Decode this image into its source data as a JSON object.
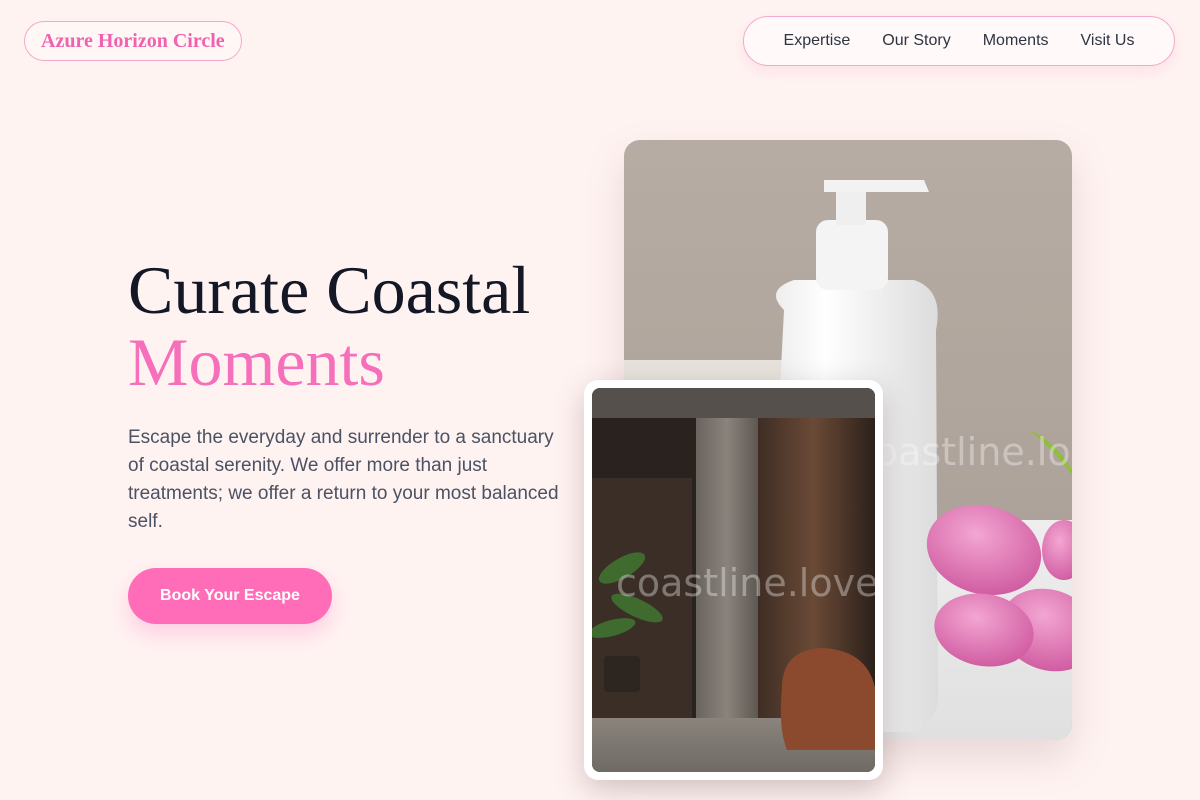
{
  "brand": {
    "name": "Azure Horizon Circle"
  },
  "nav": {
    "items": [
      {
        "label": "Expertise"
      },
      {
        "label": "Our Story"
      },
      {
        "label": "Moments"
      },
      {
        "label": "Visit Us"
      }
    ]
  },
  "hero": {
    "title_line1": "Curate Coastal",
    "title_line2": "Moments",
    "description": "Escape the everyday and surrender to a sanctuary of coastal serenity. We offer more than just treatments; we offer a return to your most balanced self.",
    "cta_label": "Book Your Escape"
  },
  "images": {
    "main_watermark": "coastline.love",
    "inset_watermark": "coastline.love"
  },
  "colors": {
    "background": "#fff3f2",
    "accent": "#f56fba",
    "cta": "#ff6db8",
    "text_dark": "#141826",
    "text_body": "#4b5263"
  }
}
